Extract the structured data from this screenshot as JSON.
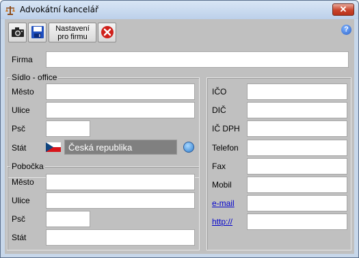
{
  "window": {
    "title": "Advokátní kancelář"
  },
  "toolbar": {
    "settings_label": "Nastavení\npro firmu"
  },
  "labels": {
    "firma": "Firma",
    "sidlo_legend": "Sídlo - office",
    "pobocka_legend": "Pobočka",
    "mesto": "Město",
    "ulice": "Ulice",
    "psc": "Psč",
    "stat": "Stát",
    "ico": "IČO",
    "dic": "DIČ",
    "ic_dph": "IČ DPH",
    "telefon": "Telefon",
    "fax": "Fax",
    "mobil": "Mobil",
    "email": "e-mail",
    "http": "http://"
  },
  "values": {
    "country": "Česká republika"
  },
  "colors": {
    "window_bg": "#c0c0c0",
    "titlebar": "#c7d7ea",
    "link": "#0000cc",
    "country_box": "#808080"
  }
}
